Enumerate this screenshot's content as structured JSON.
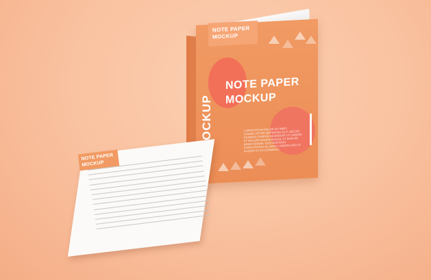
{
  "scene": {
    "description_colors": {
      "background": "#f9c09e",
      "box": "#ec8d56",
      "accent_circle": "#f26a58"
    },
    "box": {
      "top_label_line1": "NOTE PAPER",
      "top_label_line2": "MOCKUP",
      "vertical_text": "MOCKUP",
      "title_line1": "NOTE PAPER",
      "title_line2": "MOCKUP",
      "body_text": "LOREM IPSUM DOLOR SIT AMET, CONSECTETUR ADIPISCING ELIT, SED DO EIUSMOD TEMPOR INCIDIDUNT UT LABORE ET DOLORE MAGNA ALIQUA. UT ENIM AD MINIM VENIAM, QUIS NOSTRUD EXERCITATION ULLAMCO LABORIS NISI UT ALIQUIP EX EA COMMODO."
    },
    "sheet": {
      "label_line1": "NOTE PAPER",
      "label_line2": "MOCKUP"
    }
  }
}
